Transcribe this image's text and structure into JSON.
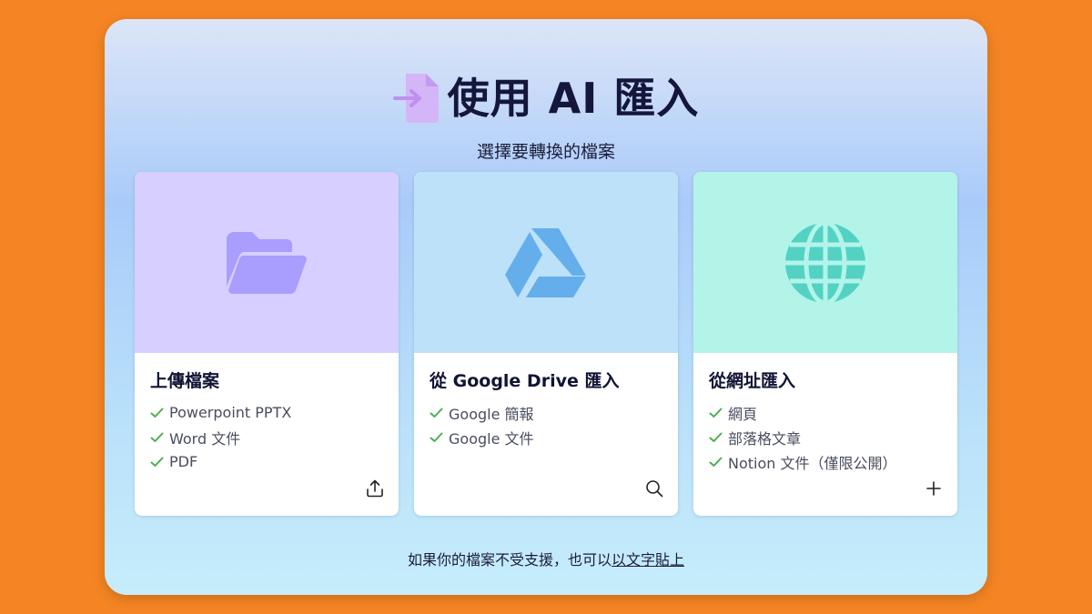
{
  "header": {
    "title": "使用 AI 匯入",
    "subtitle": "選擇要轉換的檔案",
    "icon": "file-import-icon"
  },
  "cards": [
    {
      "title": "上傳檔案",
      "icon": "folder-open-icon",
      "color": "#A99DFD",
      "features": [
        "Powerpoint PPTX",
        "Word 文件",
        "PDF"
      ],
      "action_icon": "upload-icon"
    },
    {
      "title": "從 Google Drive 匯入",
      "icon": "google-drive-icon",
      "color": "#64AEEB",
      "features": [
        "Google 簡報",
        "Google 文件"
      ],
      "action_icon": "search-icon"
    },
    {
      "title": "從網址匯入",
      "icon": "globe-icon",
      "color": "#53D2C3",
      "features": [
        "網頁",
        "部落格文章",
        "Notion 文件（僅限公開）"
      ],
      "action_icon": "plus-icon"
    }
  ],
  "footer": {
    "text": "如果你的檔案不受支援，也可以",
    "link": "以文字貼上"
  },
  "colors": {
    "background": "#F58523",
    "check": "#4CAF50",
    "title": "#14163D"
  }
}
